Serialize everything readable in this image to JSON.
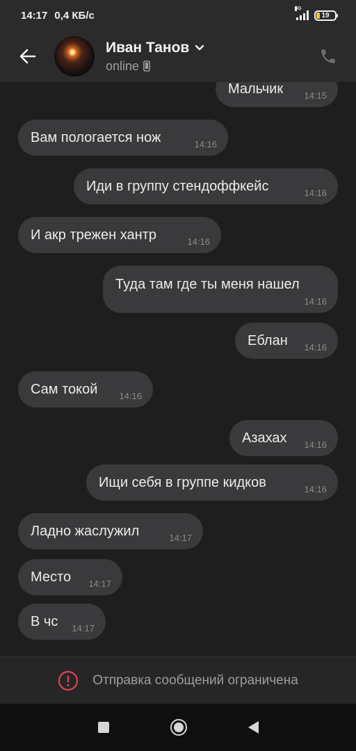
{
  "status_bar": {
    "time": "14:17",
    "net_speed": "0,4 КБ/с",
    "network_type": "4G",
    "battery": "19",
    "battery_level": 0.19
  },
  "header": {
    "contact_name": "Иван Танов",
    "status": "online",
    "icons": [
      "back-arrow-icon",
      "chevron-down-icon",
      "mobile-device-icon",
      "phone-icon"
    ]
  },
  "messages": [
    {
      "dir": "out",
      "text": "Мальчик",
      "time": "14:15"
    },
    {
      "dir": "in",
      "text": "Вам пологается нож",
      "time": "14:16"
    },
    {
      "dir": "out",
      "text": "Иди в группу стендоффкейс",
      "time": "14:16"
    },
    {
      "dir": "in",
      "text": "И акр трежен хантр",
      "time": "14:16"
    },
    {
      "dir": "out",
      "text": "Туда там где ты меня нашел",
      "time": "14:16"
    },
    {
      "dir": "out",
      "text": "Еблан",
      "time": "14:16"
    },
    {
      "dir": "in",
      "text": "Сам токой",
      "time": "14:16"
    },
    {
      "dir": "out",
      "text": "Азахах",
      "time": "14:16"
    },
    {
      "dir": "out",
      "text": "Ищи себя в группе кидков",
      "time": "14:16"
    },
    {
      "dir": "in",
      "text": "Ладно жаслужил",
      "time": "14:17"
    },
    {
      "dir": "in",
      "text": "Место",
      "time": "14:17"
    },
    {
      "dir": "in",
      "text": "В чс",
      "time": "14:17"
    }
  ],
  "restriction": {
    "text": "Отправка сообщений ограничена",
    "icon": "alert-circle-icon",
    "accent": "#e0444e"
  },
  "colors": {
    "background": "#1e1e1f",
    "bar": "#2b2b2c",
    "bubble": "#3a3a3c"
  }
}
